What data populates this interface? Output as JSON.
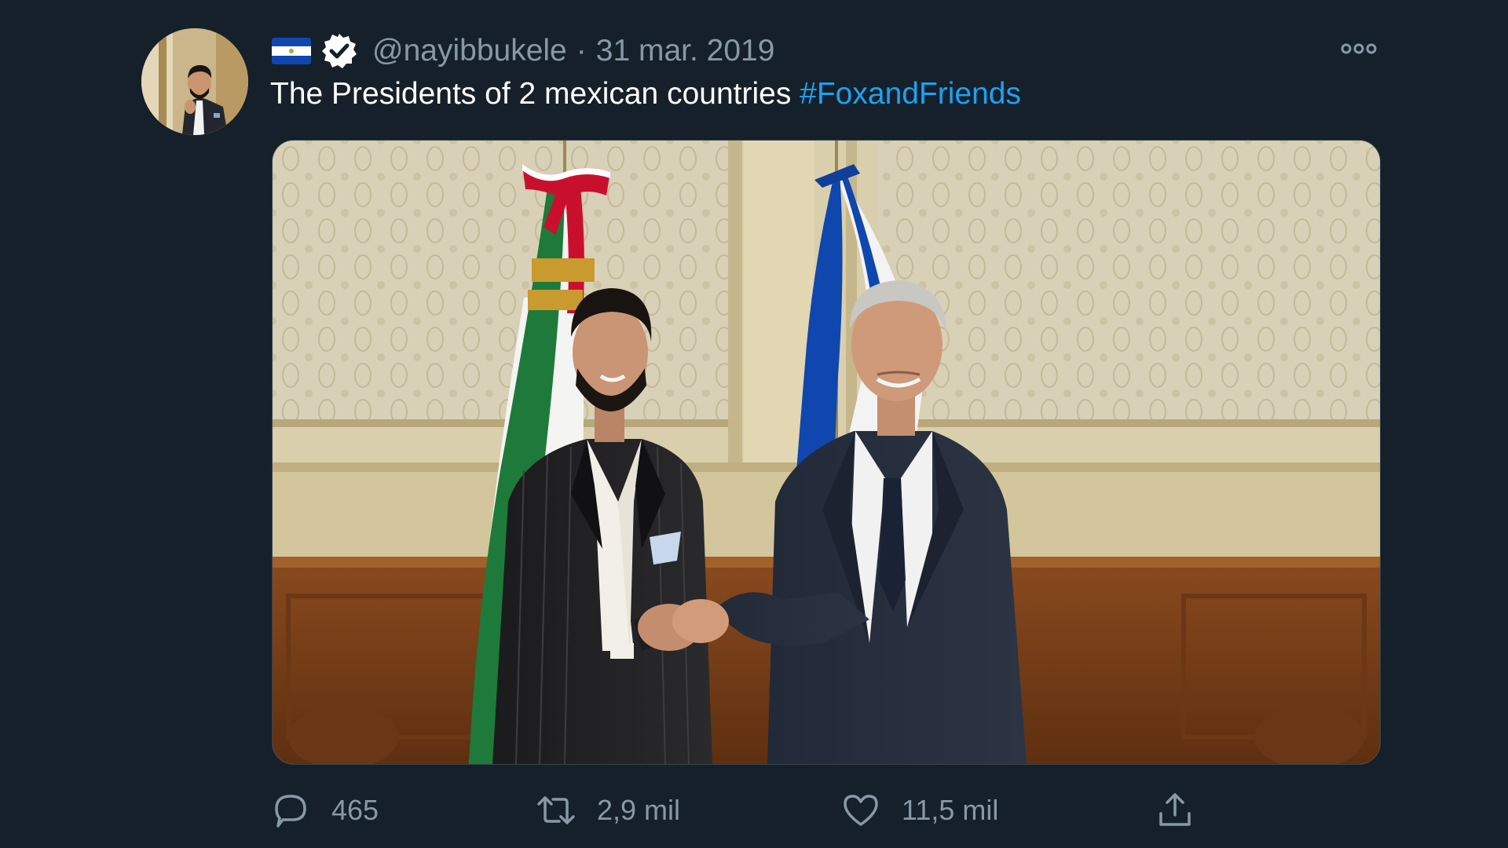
{
  "tweet": {
    "handle": "@nayibbukele",
    "separator": "·",
    "date": "31 mar. 2019",
    "text": "The Presidents of 2 mexican countries",
    "hashtag": "#FoxandFriends"
  },
  "icons": {
    "flag": "el-salvador-flag-icon",
    "verified": "verified-badge-icon",
    "more": "more-options-icon",
    "reply": "reply-icon",
    "retweet": "retweet-icon",
    "like": "like-icon",
    "share": "share-icon"
  },
  "actions": {
    "reply_count": "465",
    "retweet_count": "2,9 mil",
    "like_count": "11,5 mil"
  },
  "colors": {
    "background": "#15202b",
    "text": "#ffffff",
    "muted": "#8899a6",
    "link": "#1da1f2"
  }
}
